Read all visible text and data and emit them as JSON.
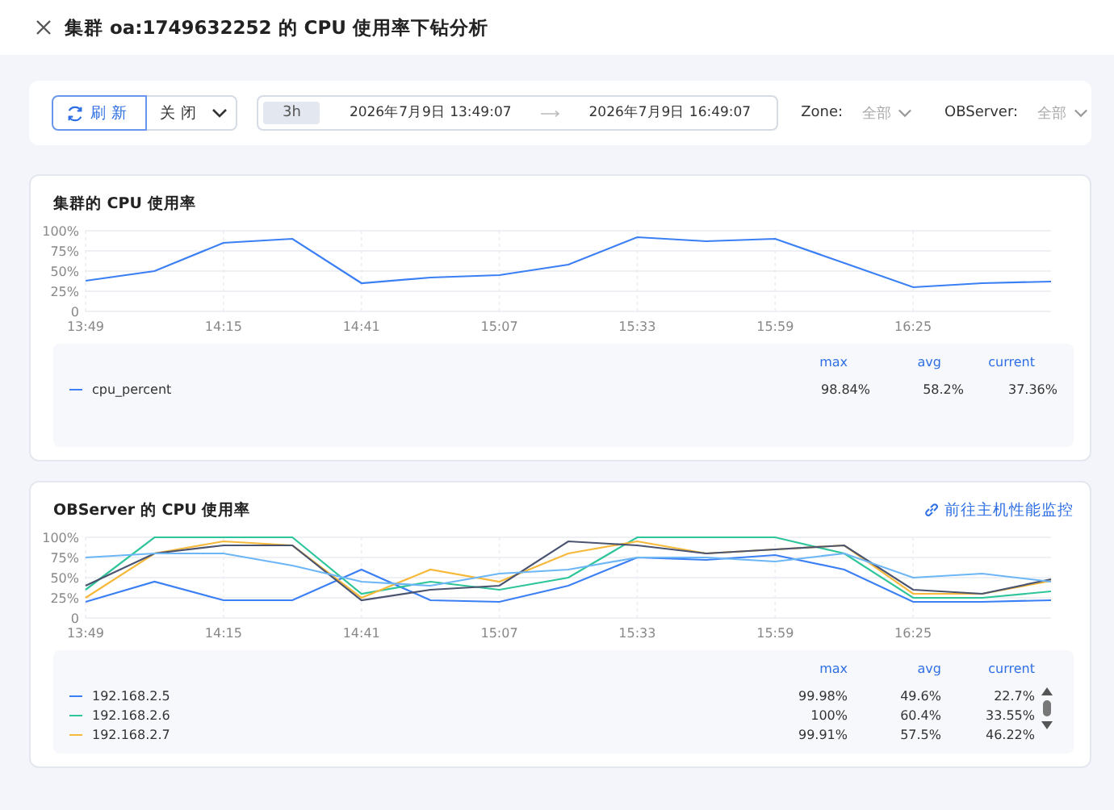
{
  "header": {
    "title": "集群 oa:1749632252 的 CPU 使用率下钻分析"
  },
  "toolbar": {
    "refresh_button": "刷新",
    "auto_refresh": "关闭",
    "range": {
      "preset": "3h",
      "start": "2026年7月9日 13:49:07",
      "end": "2026年7月9日 16:49:07"
    },
    "filters": [
      {
        "label": "Zone:",
        "value": "全部"
      },
      {
        "label": "OBServer:",
        "value": "全部"
      }
    ]
  },
  "panels": [
    {
      "title": "集群的 CPU 使用率",
      "chart_data": {
        "type": "line",
        "grid": true,
        "categories": [
          "13:49",
          null,
          "14:15",
          null,
          "14:41",
          null,
          "15:07",
          null,
          "15:33",
          null,
          "15:59",
          null,
          "16:25",
          null,
          null
        ],
        "ylim": [
          0,
          100
        ],
        "yticks": [
          {
            "value": 0,
            "label": "0"
          },
          {
            "value": 25,
            "label": "25%"
          },
          {
            "value": 50,
            "label": "50%"
          },
          {
            "value": 75,
            "label": "75%"
          },
          {
            "value": 100,
            "label": "100%"
          }
        ],
        "series": [
          {
            "name": "cpu_percent",
            "color": "#3b7ff5",
            "values": [
              38,
              50,
              85,
              90,
              35,
              42,
              45,
              58,
              92,
              87,
              90,
              60,
              30,
              35,
              37
            ]
          }
        ]
      },
      "legend": {
        "columns": [
          "max",
          "avg",
          "current"
        ],
        "rows": [
          {
            "values": [
              "98.84%",
              "58.2%",
              "37.36%"
            ]
          }
        ]
      }
    },
    {
      "title": "OBServer 的 CPU 使用率",
      "link": "前往主机性能监控",
      "chart_data": {
        "type": "line",
        "grid": true,
        "categories": [
          "13:49",
          null,
          "14:15",
          null,
          "14:41",
          null,
          "15:07",
          null,
          "15:33",
          null,
          "15:59",
          null,
          "16:25",
          null,
          null
        ],
        "ylim": [
          0,
          100
        ],
        "yticks": [
          {
            "value": 0,
            "label": "0"
          },
          {
            "value": 25,
            "label": "25%"
          },
          {
            "value": 50,
            "label": "50%"
          },
          {
            "value": 75,
            "label": "75%"
          },
          {
            "value": 100,
            "label": "100%"
          }
        ],
        "series": [
          {
            "name": "192.168.2.5",
            "color": "#3b7ff5",
            "values": [
              20,
              45,
              22,
              22,
              60,
              22,
              20,
              40,
              75,
              72,
              78,
              60,
              20,
              20,
              22
            ]
          },
          {
            "name": "192.168.2.6",
            "color": "#2fc59a",
            "values": [
              35,
              100,
              100,
              100,
              30,
              45,
              35,
              50,
              100,
              100,
              100,
              80,
              25,
              25,
              33
            ]
          },
          {
            "name": "192.168.2.7",
            "color": "#f6b93b",
            "values": [
              25,
              80,
              95,
              90,
              25,
              60,
              45,
              80,
              95,
              80,
              85,
              90,
              30,
              30,
              46
            ]
          },
          {
            "color": "#4a5470",
            "values": [
              40,
              80,
              90,
              90,
              22,
              35,
              40,
              95,
              90,
              80,
              85,
              90,
              35,
              30,
              48
            ]
          },
          {
            "color": "#6cb6f6",
            "values": [
              75,
              80,
              80,
              65,
              45,
              40,
              55,
              60,
              75,
              75,
              70,
              80,
              50,
              55,
              45
            ]
          }
        ]
      },
      "legend": {
        "columns": [
          "max",
          "avg",
          "current"
        ],
        "rows": [
          {
            "values": [
              "99.98%",
              "49.6%",
              "22.7%"
            ]
          },
          {
            "values": [
              "100%",
              "60.4%",
              "33.55%"
            ]
          },
          {
            "values": [
              "99.91%",
              "57.5%",
              "46.22%"
            ]
          }
        ]
      }
    }
  ]
}
